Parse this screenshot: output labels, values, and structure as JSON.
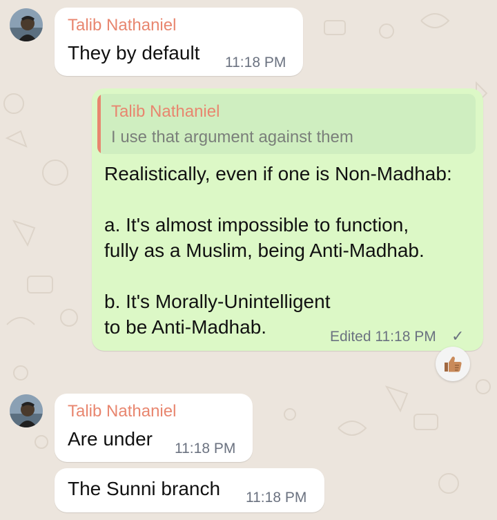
{
  "messages": [
    {
      "sender": "Talib Nathaniel",
      "text": "They by default",
      "time": "11:18 PM"
    },
    {
      "reply_to": {
        "sender": "Talib Nathaniel",
        "text": "I use that argument against them"
      },
      "lines": [
        "Realistically, even if one is Non-Madhab:",
        "",
        "a. It's almost impossible to function,",
        "fully as a Muslim, being Anti-Madhab.",
        "",
        "b. It's Morally-Unintelligent",
        "to be Anti-Madhab."
      ],
      "status": "Edited 11:18 PM",
      "tick": "✓",
      "reaction": "thumbs-up"
    },
    {
      "sender": "Talib Nathaniel",
      "text": "Are under",
      "time": "11:18 PM"
    },
    {
      "text": "The Sunni branch",
      "time": "11:18 PM"
    }
  ],
  "colors": {
    "background": "#ece5dd",
    "incoming": "#ffffff",
    "outgoing": "#dcf8c6",
    "sender_name": "#e8866f",
    "timestamp": "#6b7280"
  }
}
